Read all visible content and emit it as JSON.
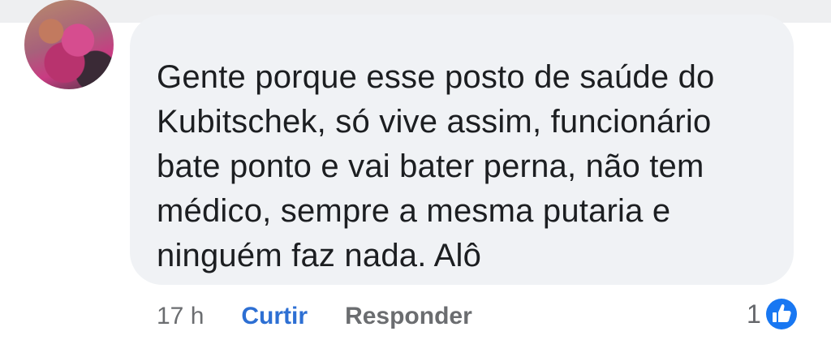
{
  "comment": {
    "lines": [
      "Gente porque esse posto de saúde do",
      "Kubitschek, só vive assim, funcionário",
      "bate ponto e vai bater perna, não tem",
      "médico, sempre a mesma putaria e",
      "ninguém faz nada. Alô"
    ]
  },
  "actions": {
    "time": "17 h",
    "like_label": "Curtir",
    "reply_label": "Responder"
  },
  "reactions": {
    "count": "1",
    "icon": "thumbs-up-icon",
    "accent": "#1877f2"
  },
  "colors": {
    "bubble": "#f0f2f5",
    "link_blue": "#2d6fd3",
    "muted": "#65676b"
  }
}
